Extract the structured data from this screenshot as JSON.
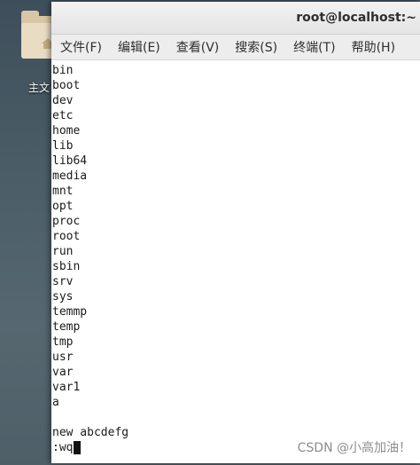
{
  "desktop": {
    "folder_label": "主文"
  },
  "window": {
    "title": "root@localhost:~"
  },
  "menu": [
    {
      "label": "文件(F)"
    },
    {
      "label": "编辑(E)"
    },
    {
      "label": "查看(V)"
    },
    {
      "label": "搜索(S)"
    },
    {
      "label": "终端(T)"
    },
    {
      "label": "帮助(H)"
    }
  ],
  "terminal": {
    "lines": [
      "bin",
      "boot",
      "dev",
      "etc",
      "home",
      "lib",
      "lib64",
      "media",
      "mnt",
      "opt",
      "proc",
      "root",
      "run",
      "sbin",
      "srv",
      "sys",
      "temmp",
      "temp",
      "tmp",
      "usr",
      "var",
      "var1",
      "a",
      "",
      "new abcdefg"
    ],
    "command": ":wq"
  },
  "watermark": "CSDN @小高加油！"
}
